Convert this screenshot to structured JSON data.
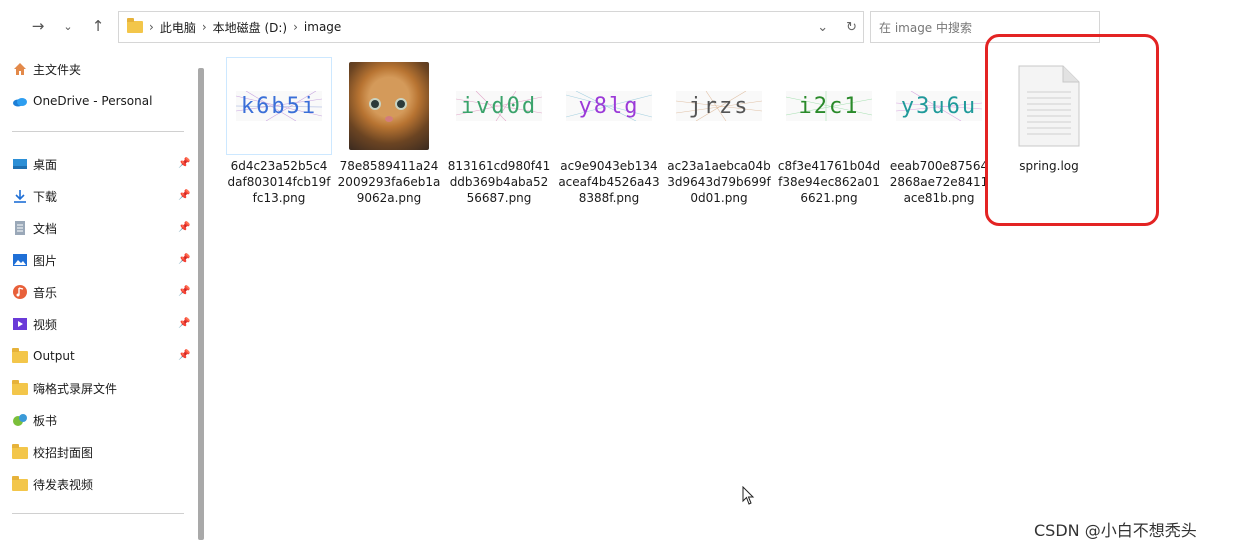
{
  "navbar": {
    "back_icon": "arrow-right-icon",
    "breadcrumb": [
      "此电脑",
      "本地磁盘 (D:)",
      "image"
    ],
    "search_placeholder": "在 image 中搜索"
  },
  "sidebar": {
    "items": [
      {
        "label": "主文件夹",
        "icon": "home-icon"
      },
      {
        "label": "OneDrive - Personal",
        "icon": "cloud-icon"
      },
      {
        "label": "桌面",
        "icon": "desktop-icon",
        "pinned": true
      },
      {
        "label": "下载",
        "icon": "download-icon",
        "pinned": true
      },
      {
        "label": "文档",
        "icon": "document-icon",
        "pinned": true
      },
      {
        "label": "图片",
        "icon": "picture-icon",
        "pinned": true
      },
      {
        "label": "音乐",
        "icon": "music-icon",
        "pinned": true
      },
      {
        "label": "视频",
        "icon": "video-icon",
        "pinned": true
      },
      {
        "label": "Output",
        "icon": "folder-icon",
        "pinned": true
      },
      {
        "label": "嗨格式录屏文件",
        "icon": "folder-icon"
      },
      {
        "label": "板书",
        "icon": "app-icon"
      },
      {
        "label": "校招封面图",
        "icon": "folder-icon"
      },
      {
        "label": "待发表视频",
        "icon": "folder-icon"
      }
    ]
  },
  "files": [
    {
      "name": "6d4c23a52b5c4daf803014fcb19ffc13.png",
      "preview": "k6b5i",
      "color": "#3a6fd8"
    },
    {
      "name": "78e8589411a242009293fa6eb1a9062a.png",
      "preview": "",
      "color": "#b87432"
    },
    {
      "name": "813161cd980f41ddb369b4aba5256687.png",
      "preview": "ivd0d",
      "color": "#3aa36b"
    },
    {
      "name": "ac9e9043eb134aceaf4b4526a438388f.png",
      "preview": "y8lg",
      "color": "#9b3ad8"
    },
    {
      "name": "ac23a1aebca04b3d9643d79b699f0d01.png",
      "preview": "jrzs",
      "color": "#555555"
    },
    {
      "name": "c8f3e41761b04df38e94ec862a016621.png",
      "preview": "i2c1",
      "color": "#2a8a2a"
    },
    {
      "name": "eeab700e875642868ae72e8411ace81b.png",
      "preview": "y3u6u",
      "color": "#1f9a9a"
    },
    {
      "name": "spring.log",
      "preview": "",
      "color": "#888888"
    }
  ],
  "watermark": "CSDN @小白不想秃头",
  "colors": {
    "highlight": "#e32323",
    "selection": "#cde8ff"
  }
}
